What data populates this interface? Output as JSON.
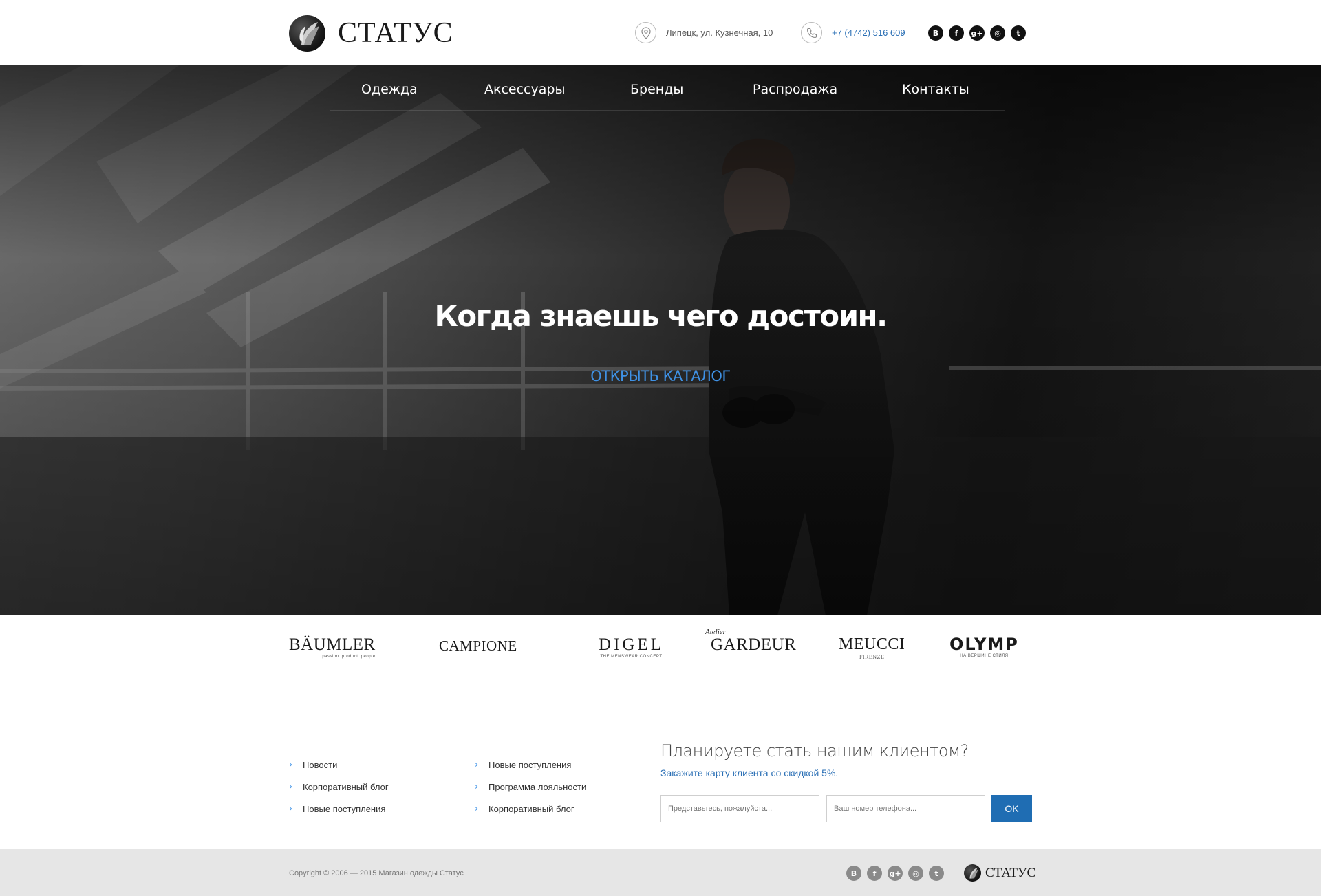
{
  "header": {
    "logo_text": "СТАТУС",
    "address": "Липецк, ул. Кузнечная, 10",
    "phone": "+7 (4742) 516 609",
    "address_icon": "map-pin-icon",
    "phone_icon": "phone-icon",
    "socials": [
      {
        "name": "vk-icon",
        "glyph": "B"
      },
      {
        "name": "facebook-icon",
        "glyph": "f"
      },
      {
        "name": "google-plus-icon",
        "glyph": "g+"
      },
      {
        "name": "instagram-icon",
        "glyph": "◎"
      },
      {
        "name": "twitter-icon",
        "glyph": "t"
      }
    ]
  },
  "nav": {
    "items": [
      {
        "label": "Одежда"
      },
      {
        "label": "Аксессуары"
      },
      {
        "label": "Бренды"
      },
      {
        "label": "Распродажа"
      },
      {
        "label": "Контакты"
      }
    ]
  },
  "hero": {
    "title": "Когда знаешь чего достоин.",
    "cta_label": "ОТКРЫТЬ КАТАЛОГ"
  },
  "brands": [
    {
      "main": "BÄUMLER",
      "sub": "passion. product. people"
    },
    {
      "main": "CAMPIONE",
      "sub": ""
    },
    {
      "main": "DIGEL",
      "sub": "THE MENSWEAR CONCEPT"
    },
    {
      "top": "Atelier",
      "main": "GARDEUR",
      "sub": ""
    },
    {
      "main": "MEUCCI",
      "sub": "FIRENZE"
    },
    {
      "main": "OLYMP",
      "sub": "НА ВЕРШИНЕ СТИЛЯ"
    }
  ],
  "links": {
    "col1": [
      {
        "label": "Новости"
      },
      {
        "label": "Корпоративный блог"
      },
      {
        "label": "Новые поступления"
      }
    ],
    "col2": [
      {
        "label": "Новые поступления"
      },
      {
        "label": "Программа лояльности"
      },
      {
        "label": "Корпоративный блог"
      }
    ]
  },
  "signup": {
    "title": "Планируете стать нашим клиентом?",
    "subtitle": "Закажите карту клиента со скидкой 5%.",
    "name_placeholder": "Представьтесь, пожалуйста...",
    "phone_placeholder": "Ваш номер телефона...",
    "submit_label": "OK"
  },
  "footer": {
    "copyright": "Copyright © 2006 — 2015 Магазин одежды Статус",
    "logo_text": "СТАТУС"
  },
  "colors": {
    "accent": "#3f92e6",
    "link_blue": "#2a6fb5",
    "button_blue": "#1f6db3",
    "footer_bg": "#e6e6e6"
  }
}
